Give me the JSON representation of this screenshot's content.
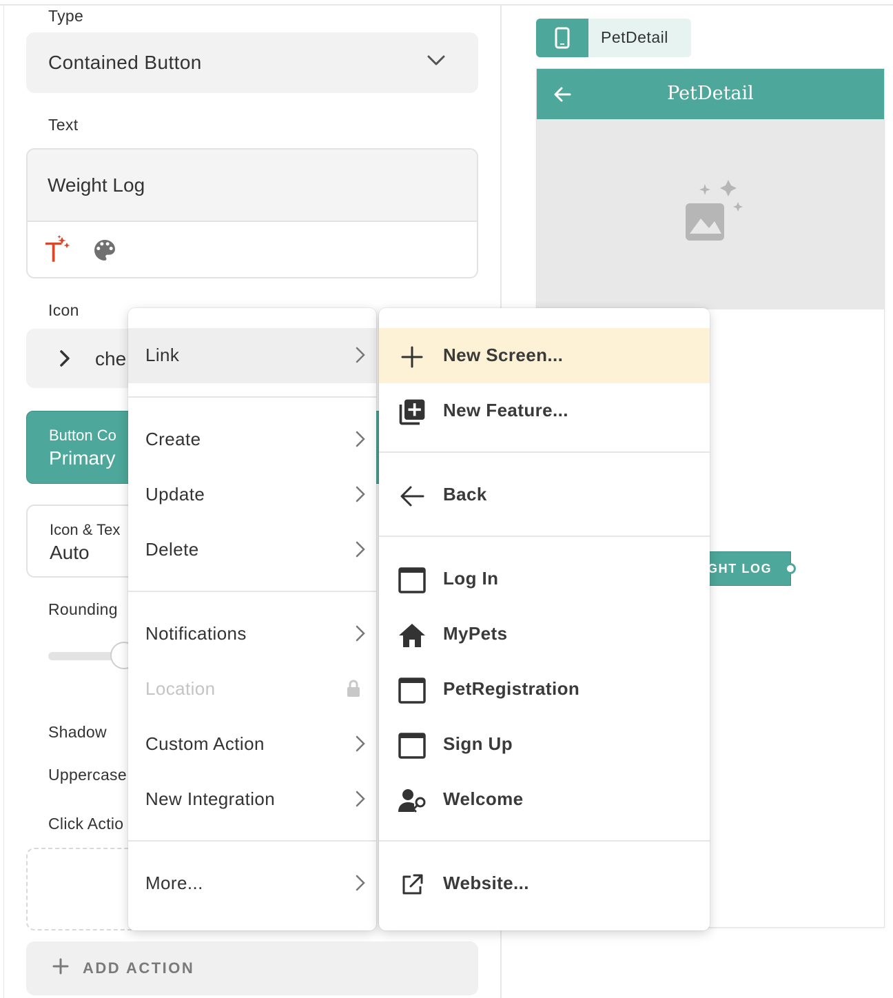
{
  "left_panel": {
    "type_label": "Type",
    "type_value": "Contained Button",
    "text_label": "Text",
    "text_value": "Weight Log",
    "icon_label": "Icon",
    "icon_value": "che",
    "button_color_label": "Button Co",
    "button_color_value": "Primary",
    "icon_text_label": "Icon & Tex",
    "icon_text_value": "Auto",
    "rounding_label": "Rounding",
    "shadow_label": "Shadow",
    "uppercase_label": "Uppercase",
    "click_action_label": "Click Actio",
    "add_action_label": "ADD ACTION"
  },
  "preview": {
    "tab_name": "PetDetail",
    "appbar_title": "PetDetail",
    "button_text": "GHT LOG"
  },
  "menu_primary": {
    "items": [
      {
        "label": "Link"
      },
      {
        "label": "Create"
      },
      {
        "label": "Update"
      },
      {
        "label": "Delete"
      },
      {
        "label": "Notifications"
      },
      {
        "label": "Location"
      },
      {
        "label": "Custom Action"
      },
      {
        "label": "New Integration"
      },
      {
        "label": "More..."
      }
    ]
  },
  "menu_link": {
    "items": [
      {
        "label": "New Screen...",
        "icon": "plus-icon"
      },
      {
        "label": "New Feature...",
        "icon": "library-add-icon"
      },
      {
        "label": "Back",
        "icon": "arrow-left-icon"
      },
      {
        "label": "Log In",
        "icon": "screen-window-icon"
      },
      {
        "label": "MyPets",
        "icon": "home-icon"
      },
      {
        "label": "PetRegistration",
        "icon": "screen-window-icon"
      },
      {
        "label": "Sign Up",
        "icon": "screen-window-icon"
      },
      {
        "label": "Welcome",
        "icon": "person-key-icon"
      },
      {
        "label": "Website...",
        "icon": "external-link-icon"
      }
    ]
  },
  "colors": {
    "primary": "#4da79a",
    "hover_yellow": "#fdf2d5",
    "magic_icon": "#d9472b"
  }
}
